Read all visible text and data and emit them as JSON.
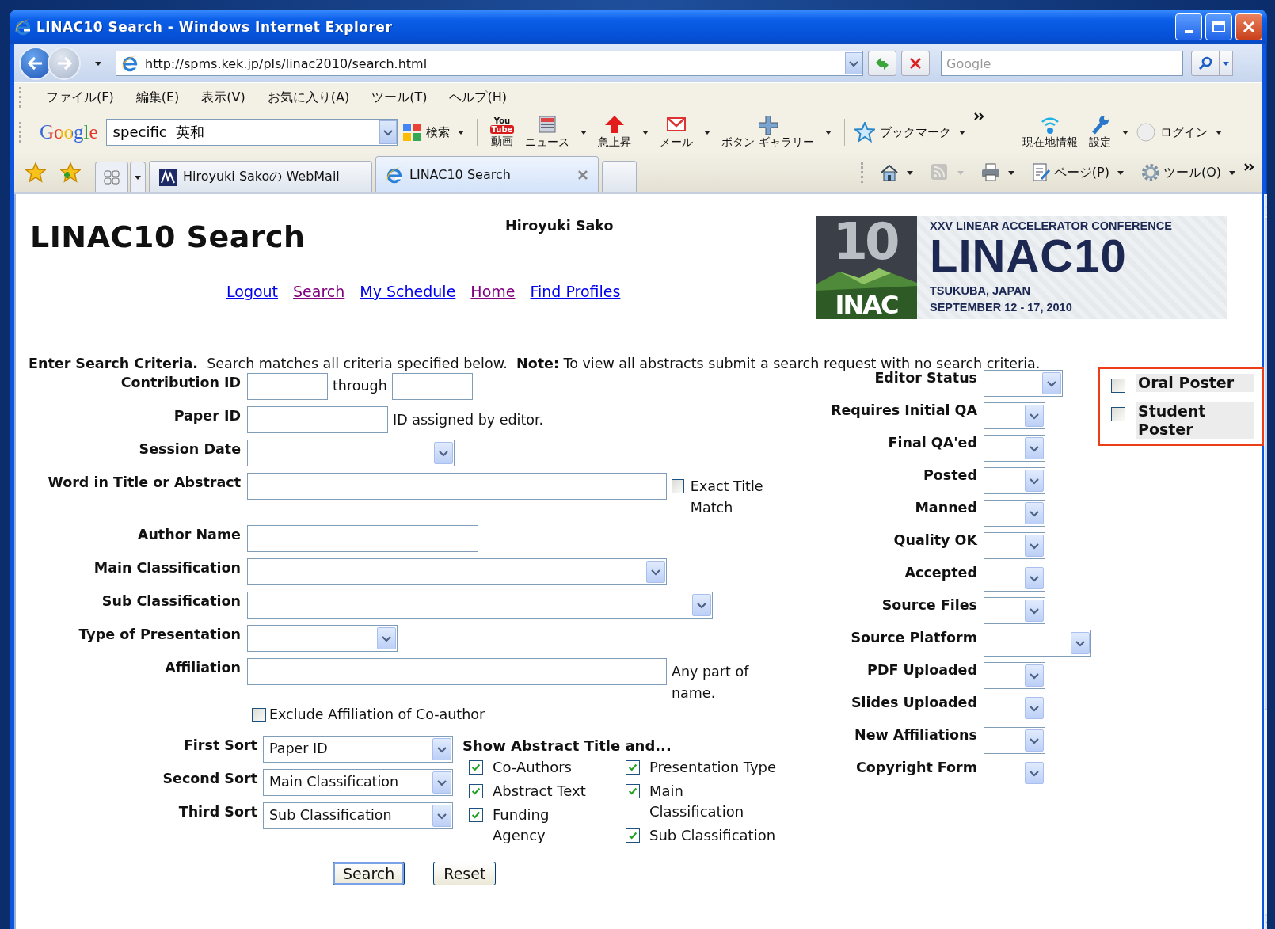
{
  "window": {
    "title": "LINAC10 Search - Windows Internet Explorer"
  },
  "address_bar": {
    "url": "http://spms.kek.jp/pls/linac2010/search.html"
  },
  "search_box": {
    "placeholder": "Google"
  },
  "menu": [
    "ファイル(F)",
    "編集(E)",
    "表示(V)",
    "お気に入り(A)",
    "ツール(T)",
    "ヘルプ(H)"
  ],
  "google_toolbar": {
    "logo": "Google",
    "query": "specific  英和",
    "search_label": "検索",
    "buttons": [
      {
        "kind": "video",
        "label": "動画",
        "icon_text": [
          "You",
          "Tube"
        ],
        "dropdown": false
      },
      {
        "kind": "news",
        "label": "ニュース",
        "dropdown": true
      },
      {
        "kind": "trend",
        "label": "急上昇",
        "dropdown": true
      },
      {
        "kind": "mail",
        "label": "メール",
        "dropdown": true
      },
      {
        "kind": "gallery",
        "label": "ボタン ギャラリー",
        "dropdown": true
      }
    ],
    "bookmarks": "ブックマーク",
    "extras": [
      {
        "kind": "location",
        "label": "現在地情報",
        "dropdown": false
      },
      {
        "kind": "settings",
        "label": "設定",
        "dropdown": true
      }
    ],
    "login": "ログイン"
  },
  "tabs": [
    {
      "kind": "webmail",
      "label": "Hiroyuki Sakoの WebMail",
      "selected": false
    },
    {
      "kind": "ie",
      "label": "LINAC10 Search",
      "selected": true
    }
  ],
  "command_bar": [
    {
      "kind": "home",
      "disabled": false
    },
    {
      "kind": "feed",
      "disabled": true
    },
    {
      "kind": "print",
      "disabled": false
    },
    {
      "kind": "page",
      "label": "ページ(P)",
      "disabled": false
    },
    {
      "kind": "tools",
      "label": "ツール(O)",
      "disabled": false
    }
  ],
  "page": {
    "title": "LINAC10 Search",
    "user": "Hiroyuki Sako",
    "links": [
      {
        "label": "Logout",
        "visited": false
      },
      {
        "label": "Search",
        "visited": true
      },
      {
        "label": "My Schedule",
        "visited": false
      },
      {
        "label": "Home",
        "visited": true
      },
      {
        "label": "Find Profiles",
        "visited": false
      }
    ],
    "logo": {
      "numeral": "10",
      "word": "INAC",
      "subtitle": "XXV LINEAR ACCELERATOR CONFERENCE",
      "name": "LINAC10",
      "place": "TSUKUBA, JAPAN",
      "dates": "SEPTEMBER 12 - 17, 2010"
    },
    "intro": "**Enter Search Criteria.**  Search matches all criteria specified below.  **Note:** To view all abstracts submit a search request with no search criteria."
  },
  "criteria": [
    {
      "label": "Contribution ID",
      "kind": "range",
      "joiner": "through"
    },
    {
      "label": "Paper ID",
      "kind": "text",
      "hint": "ID assigned by editor."
    },
    {
      "label": "Session Date",
      "kind": "select"
    },
    {
      "label": "Word in Title or Abstract",
      "kind": "text",
      "option": {
        "label": "Exact Title Match",
        "checked": false
      }
    },
    {
      "label": "Author Name",
      "kind": "text"
    },
    {
      "label": "Main Classification",
      "kind": "select"
    },
    {
      "label": "Sub Classification",
      "kind": "select"
    },
    {
      "label": "Type of Presentation",
      "kind": "select"
    },
    {
      "label": "Affiliation",
      "kind": "text",
      "hint": "Any part of name.",
      "extra_option": {
        "label": "Exclude Affiliation of Co-author",
        "checked": false
      }
    }
  ],
  "status_filters": [
    {
      "label": "Editor Status"
    },
    {
      "label": "Requires Initial QA"
    },
    {
      "label": "Final QA'ed"
    },
    {
      "label": "Posted"
    },
    {
      "label": "Manned"
    },
    {
      "label": "Quality OK"
    },
    {
      "label": "Accepted"
    },
    {
      "label": "Source Files"
    },
    {
      "label": "Source Platform"
    },
    {
      "label": "PDF Uploaded"
    },
    {
      "label": "Slides Uploaded"
    },
    {
      "label": "New Affiliations"
    },
    {
      "label": "Copyright Form"
    }
  ],
  "poster_filters": [
    {
      "label": "Oral Poster",
      "checked": false
    },
    {
      "label": "Student Poster",
      "checked": false
    }
  ],
  "sort": [
    {
      "label": "First Sort",
      "value": "Paper ID"
    },
    {
      "label": "Second Sort",
      "value": "Main Classification"
    },
    {
      "label": "Third Sort",
      "value": "Sub Classification"
    }
  ],
  "show_abstract": {
    "title": "Show Abstract Title and...",
    "columns": [
      [
        {
          "label": "Co-Authors",
          "checked": true
        },
        {
          "label": "Abstract Text",
          "checked": true
        },
        {
          "label": "Funding Agency",
          "checked": true
        }
      ],
      [
        {
          "label": "Presentation Type",
          "checked": true
        },
        {
          "label": "Main Classification",
          "checked": true
        },
        {
          "label": "Sub Classification",
          "checked": true
        }
      ]
    ]
  },
  "buttons": [
    {
      "label": "Search",
      "selected": true
    },
    {
      "label": "Reset",
      "selected": false
    }
  ]
}
